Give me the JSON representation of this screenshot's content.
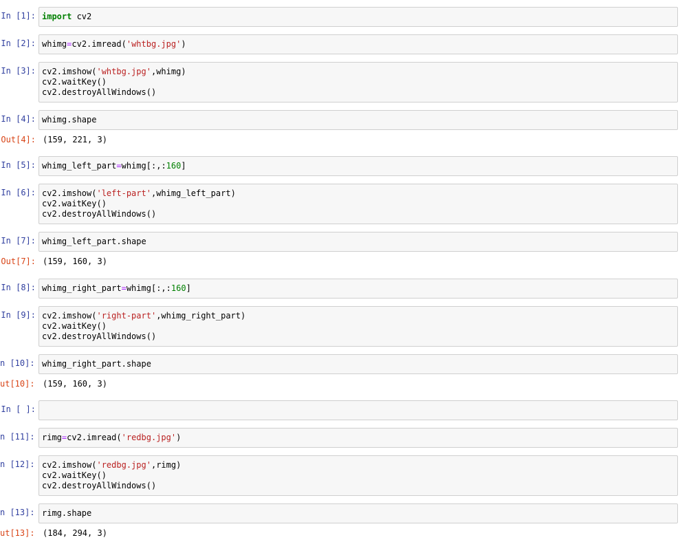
{
  "cells": [
    {
      "prompt": "In [1]:",
      "code": [
        "import cv2"
      ]
    },
    {
      "prompt": "In [2]:",
      "code": [
        "whimg=cv2.imread('whtbg.jpg')"
      ]
    },
    {
      "prompt": "In [3]:",
      "code": [
        "cv2.imshow('whtbg.jpg',whimg)",
        "cv2.waitKey()",
        "cv2.destroyAllWindows()"
      ]
    },
    {
      "prompt": "In [4]:",
      "code": [
        "whimg.shape"
      ],
      "out_prompt": "Out[4]:",
      "output": "(159, 221, 3)"
    },
    {
      "prompt": "In [5]:",
      "code": [
        "whimg_left_part=whimg[:,:160]"
      ]
    },
    {
      "prompt": "In [6]:",
      "code": [
        "cv2.imshow('left-part',whimg_left_part)",
        "cv2.waitKey()",
        "cv2.destroyAllWindows()"
      ]
    },
    {
      "prompt": "In [7]:",
      "code": [
        "whimg_left_part.shape"
      ],
      "out_prompt": "Out[7]:",
      "output": "(159, 160, 3)"
    },
    {
      "prompt": "In [8]:",
      "code": [
        "whimg_right_part=whimg[:,:160]"
      ]
    },
    {
      "prompt": "In [9]:",
      "code": [
        "cv2.imshow('right-part',whimg_right_part)",
        "cv2.waitKey()",
        "cv2.destroyAllWindows()"
      ]
    },
    {
      "prompt": "n [10]:",
      "code": [
        "whimg_right_part.shape"
      ],
      "out_prompt": "ut[10]:",
      "output": "(159, 160, 3)"
    },
    {
      "prompt": "In [ ]:",
      "code": [
        ""
      ]
    },
    {
      "prompt": "n [11]:",
      "code": [
        "rimg=cv2.imread('redbg.jpg')"
      ]
    },
    {
      "prompt": "n [12]:",
      "code": [
        "cv2.imshow('redbg.jpg',rimg)",
        "cv2.waitKey()",
        "cv2.destroyAllWindows()"
      ]
    },
    {
      "prompt": "n [13]:",
      "code": [
        "rimg.shape"
      ],
      "out_prompt": "ut[13]:",
      "output": "(184, 294, 3)"
    }
  ],
  "colors": {
    "in_prompt": "#303F9F",
    "out_prompt": "#D84315",
    "keyword": "#008000",
    "string": "#BA2121",
    "number": "#008000",
    "operator": "#AA22FF",
    "input_bg": "#f7f7f7",
    "input_border": "#cfcfcf"
  }
}
